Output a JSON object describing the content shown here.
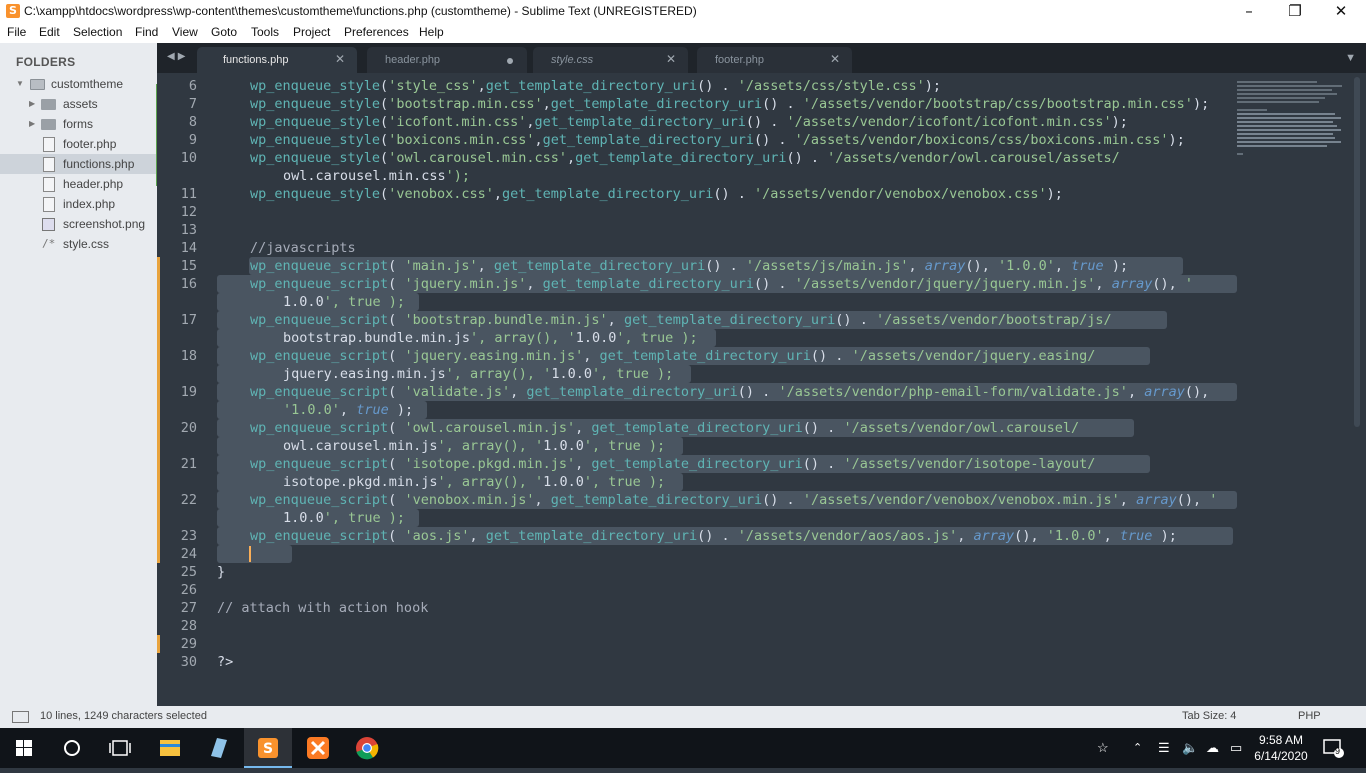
{
  "window": {
    "title": "C:\\xampp\\htdocs\\wordpress\\wp-content\\themes\\customtheme\\functions.php (customtheme) - Sublime Text (UNREGISTERED)"
  },
  "menu": [
    "File",
    "Edit",
    "Selection",
    "Find",
    "View",
    "Goto",
    "Tools",
    "Project",
    "Preferences",
    "Help"
  ],
  "sidebar": {
    "header": "FOLDERS",
    "root": "customtheme",
    "items": [
      {
        "label": "assets",
        "type": "folder"
      },
      {
        "label": "forms",
        "type": "folder"
      },
      {
        "label": "footer.php",
        "type": "file"
      },
      {
        "label": "functions.php",
        "type": "file",
        "selected": true
      },
      {
        "label": "header.php",
        "type": "file"
      },
      {
        "label": "index.php",
        "type": "file"
      },
      {
        "label": "screenshot.png",
        "type": "image"
      },
      {
        "label": "style.css",
        "type": "css"
      }
    ]
  },
  "tabs": [
    {
      "label": "functions.php",
      "active": true,
      "state": "close"
    },
    {
      "label": "header.php",
      "active": false,
      "state": "dirty"
    },
    {
      "label": "style.css",
      "active": false,
      "state": "close",
      "italic": true
    },
    {
      "label": "footer.php",
      "active": false,
      "state": "close"
    }
  ],
  "code_lines": [
    {
      "no": "6",
      "text": "wp_enqueue_style('style_css',get_template_directory_uri() . '/assets/css/style.css');"
    },
    {
      "no": "7",
      "text": "wp_enqueue_style('bootstrap.min.css',get_template_directory_uri() . '/assets/vendor/bootstrap/css/bootstrap.min.css');"
    },
    {
      "no": "8",
      "text": "wp_enqueue_style('icofont.min.css',get_template_directory_uri() . '/assets/vendor/icofont/icofont.min.css');"
    },
    {
      "no": "9",
      "text": "wp_enqueue_style('boxicons.min.css',get_template_directory_uri() . '/assets/vendor/boxicons/css/boxicons.min.css');"
    },
    {
      "no": "10",
      "text": "wp_enqueue_style('owl.carousel.min.css',get_template_directory_uri() . '/assets/vendor/owl.carousel/assets/",
      "wrap": "owl.carousel.min.css');"
    },
    {
      "no": "11",
      "text": "wp_enqueue_style('venobox.css',get_template_directory_uri() . '/assets/vendor/venobox/venobox.css');"
    },
    {
      "no": "12",
      "text": ""
    },
    {
      "no": "13",
      "text": ""
    },
    {
      "no": "14",
      "text": "//javascripts"
    },
    {
      "no": "15",
      "text": "wp_enqueue_script( 'main.js', get_template_directory_uri() . '/assets/js/main.js', array(), '1.0.0', true );"
    },
    {
      "no": "16",
      "text": "wp_enqueue_script( 'jquery.min.js', get_template_directory_uri() . '/assets/vendor/jquery/jquery.min.js', array(), '",
      "wrap": "1.0.0', true );"
    },
    {
      "no": "17",
      "text": "wp_enqueue_script( 'bootstrap.bundle.min.js', get_template_directory_uri() . '/assets/vendor/bootstrap/js/",
      "wrap": "bootstrap.bundle.min.js', array(), '1.0.0', true );"
    },
    {
      "no": "18",
      "text": "wp_enqueue_script( 'jquery.easing.min.js', get_template_directory_uri() . '/assets/vendor/jquery.easing/",
      "wrap": "jquery.easing.min.js', array(), '1.0.0', true );"
    },
    {
      "no": "19",
      "text": "wp_enqueue_script( 'validate.js', get_template_directory_uri() . '/assets/vendor/php-email-form/validate.js', array(),",
      "wrap": "'1.0.0', true );"
    },
    {
      "no": "20",
      "text": "wp_enqueue_script( 'owl.carousel.min.js', get_template_directory_uri() . '/assets/vendor/owl.carousel/",
      "wrap": "owl.carousel.min.js', array(), '1.0.0', true );"
    },
    {
      "no": "21",
      "text": "wp_enqueue_script( 'isotope.pkgd.min.js', get_template_directory_uri() . '/assets/vendor/isotope-layout/",
      "wrap": "isotope.pkgd.min.js', array(), '1.0.0', true );"
    },
    {
      "no": "22",
      "text": "wp_enqueue_script( 'venobox.min.js', get_template_directory_uri() . '/assets/vendor/venobox/venobox.min.js', array(), '",
      "wrap": "1.0.0', true );"
    },
    {
      "no": "23",
      "text": "wp_enqueue_script( 'aos.js', get_template_directory_uri() . '/assets/vendor/aos/aos.js', array(), '1.0.0', true );"
    },
    {
      "no": "24",
      "text": ""
    },
    {
      "no": "25",
      "text": "}"
    },
    {
      "no": "26",
      "text": ""
    },
    {
      "no": "27",
      "text": "// attach with action hook"
    },
    {
      "no": "28",
      "text": ""
    },
    {
      "no": "29",
      "text": ""
    },
    {
      "no": "30",
      "text": "?>"
    }
  ],
  "statusbar": {
    "selection": "10 lines, 1249 characters selected",
    "tab_size": "Tab Size: 4",
    "syntax": "PHP"
  },
  "taskbar": {
    "time": "9:58 AM",
    "date": "6/14/2020",
    "notifications": "9"
  },
  "colors": {
    "editor_bg": "#303841",
    "sidebar_bg": "#e8ebef",
    "function": "#5fb4b4",
    "string": "#99c794",
    "keyword": "#6699cc",
    "modified_gutter": "#e8a33d",
    "cursor": "#f9ae58"
  }
}
